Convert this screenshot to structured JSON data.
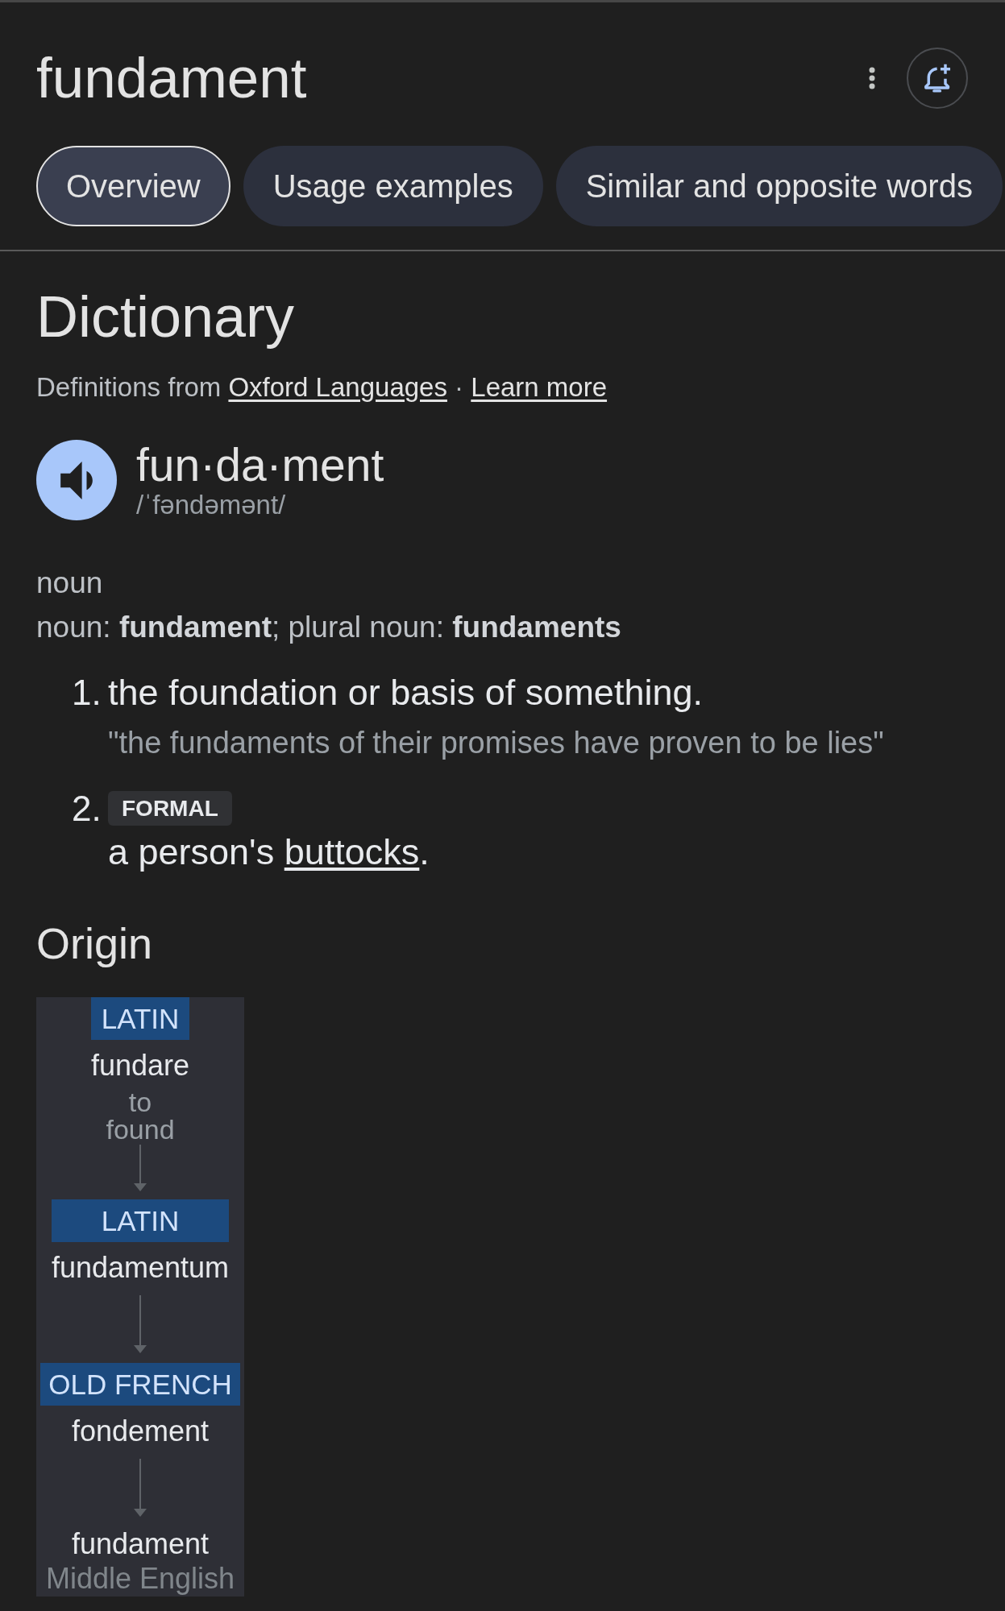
{
  "header": {
    "title": "fundament",
    "tabs": [
      {
        "label": "Overview",
        "selected": true
      },
      {
        "label": "Usage examples",
        "selected": false
      },
      {
        "label": "Similar and opposite words",
        "selected": false
      }
    ]
  },
  "dictionary": {
    "heading": "Dictionary",
    "attribution": [
      {
        "kind": "text",
        "text": "Definitions from "
      },
      {
        "kind": "link",
        "text": "Oxford Languages"
      },
      {
        "kind": "text",
        "text": " · "
      },
      {
        "kind": "link",
        "text": "Learn more"
      }
    ],
    "entry": {
      "headword": "fun·da·ment",
      "pronunciation": "/ˈfəndəmənt/",
      "part_of_speech": "noun",
      "forms": "noun: **fundament**; plural noun: **fundaments**",
      "senses": [
        {
          "number": "1.",
          "definition": [
            {
              "kind": "text",
              "text": "the foundation or basis of something."
            }
          ],
          "example": "\"the fundaments of their promises have proven to be lies\""
        },
        {
          "number": "2.",
          "register": "FORMAL",
          "definition": [
            {
              "kind": "text",
              "text": "a person's "
            },
            {
              "kind": "link",
              "text": "buttocks"
            },
            {
              "kind": "text",
              "text": "."
            }
          ]
        }
      ]
    }
  },
  "origin": {
    "heading": "Origin",
    "nodes": [
      {
        "kind": "source",
        "language": "LATIN",
        "word": "fundare",
        "gloss": "to found"
      },
      {
        "kind": "source",
        "language": "LATIN",
        "word": "fundamentum"
      },
      {
        "kind": "source",
        "language": "OLD FRENCH",
        "word": "fondement"
      },
      {
        "kind": "result",
        "word": "fundament",
        "language": "Middle English"
      }
    ]
  }
}
